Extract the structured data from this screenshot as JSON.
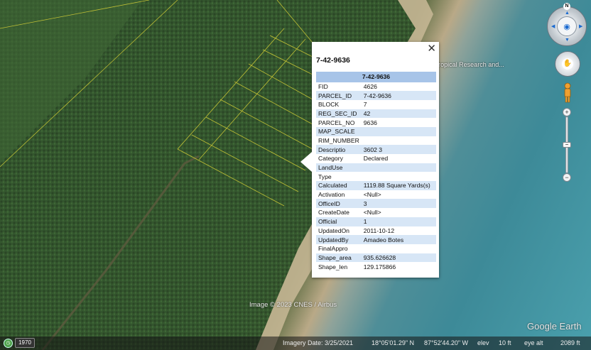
{
  "popup": {
    "close_icon": "close-icon",
    "title": "7-42-9636",
    "table_header": "7-42-9636",
    "rows": [
      {
        "key": "FID",
        "value": "4626"
      },
      {
        "key": "PARCEL_ID",
        "value": "7-42-9636"
      },
      {
        "key": "BLOCK",
        "value": "7"
      },
      {
        "key": "REG_SEC_ID",
        "value": "42"
      },
      {
        "key": "PARCEL_NO",
        "value": "9636"
      },
      {
        "key": "MAP_SCALE",
        "value": ""
      },
      {
        "key": "RIM_NUMBER",
        "value": ""
      },
      {
        "key": "Descriptio",
        "value": "3602 3"
      },
      {
        "key": "Category",
        "value": "Declared"
      },
      {
        "key": "LandUse",
        "value": ""
      },
      {
        "key": "Type",
        "value": ""
      },
      {
        "key": "Calculated",
        "value": "1119.88 Square Yards(s)"
      },
      {
        "key": "Activation",
        "value": "<Null>"
      },
      {
        "key": "OfficeID",
        "value": "3"
      },
      {
        "key": "CreateDate",
        "value": "<Null>"
      },
      {
        "key": "Official",
        "value": "1"
      },
      {
        "key": "UpdatedOn",
        "value": "2011-10-12"
      },
      {
        "key": "UpdatedBy",
        "value": "Amadeo Botes"
      },
      {
        "key": "FinalAppro",
        "value": ""
      },
      {
        "key": "Shape_area",
        "value": "935.626628"
      },
      {
        "key": "Shape_len",
        "value": "129.175866"
      }
    ]
  },
  "map": {
    "place_label": "Tropical Research and...",
    "credit": "Image © 2023 CNES / Airbus",
    "logo": "Google Earth"
  },
  "controls": {
    "compass_north": "N",
    "zoom_in": "+",
    "zoom_out": "−"
  },
  "statusbar": {
    "historical_year": "1970",
    "imagery_date": "Imagery Date: 3/25/2021",
    "latitude": "18°05'01.29\" N",
    "longitude": "87°52'44.20\" W",
    "elev_label": "elev",
    "elev_value": "10 ft",
    "eye_alt_label": "eye alt",
    "eye_alt_value": "2089 ft"
  },
  "colors": {
    "table_header_bg": "#a7c4e8",
    "table_row_shade": "#d7e6f6",
    "vegetation": "#34552d",
    "water": "#3d8a98"
  }
}
